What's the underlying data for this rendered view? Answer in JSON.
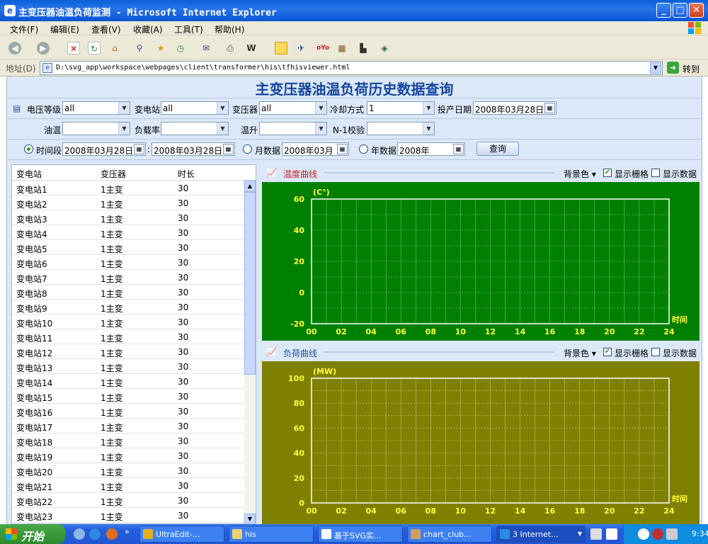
{
  "window": {
    "title": "主变压器油温负荷监测 - Microsoft Internet Explorer",
    "minimize": "_",
    "maximize": "□",
    "close": "✕"
  },
  "menu": [
    "文件(F)",
    "编辑(E)",
    "查看(V)",
    "收藏(A)",
    "工具(T)",
    "帮助(H)"
  ],
  "address": {
    "label": "地址(D)",
    "url": "D:\\svg_app\\workspace\\webpages\\client\\transformer\\his\\tfhisviewer.html",
    "go_label": "转到"
  },
  "page": {
    "title": "主变压器油温负荷历史数据查询"
  },
  "filters": {
    "voltage_label": "电压等级",
    "voltage_value": "all",
    "substation_label": "变电站",
    "substation_value": "all",
    "transformer_label": "变压器",
    "transformer_value": "all",
    "cooling_label": "冷却方式",
    "cooling_value": "1",
    "commission_label": "投产日期",
    "commission_value": "2008年03月28日",
    "oil_temp_label": "油温",
    "oil_temp_value": "",
    "load_rate_label": "负载率",
    "load_rate_value": "",
    "temp_rise_label": "温升",
    "temp_rise_value": "",
    "n1_label": "N-1校验",
    "n1_value": "",
    "period_label": "时间段",
    "period_from": "2008年03月28日",
    "period_sep": ":",
    "period_to": "2008年03月28日",
    "month_label": "月数据",
    "month_value": "2008年03月",
    "year_label": "年数据",
    "year_value": "2008年",
    "query_button": "查询"
  },
  "table": {
    "headers": [
      "变电站",
      "变压器",
      "时长"
    ],
    "rows": [
      {
        "station": "变电站1",
        "transformer": "1主变",
        "duration": "30"
      },
      {
        "station": "变电站2",
        "transformer": "1主变",
        "duration": "30"
      },
      {
        "station": "变电站3",
        "transformer": "1主变",
        "duration": "30"
      },
      {
        "station": "变电站4",
        "transformer": "1主变",
        "duration": "30"
      },
      {
        "station": "变电站5",
        "transformer": "1主变",
        "duration": "30"
      },
      {
        "station": "变电站6",
        "transformer": "1主变",
        "duration": "30"
      },
      {
        "station": "变电站7",
        "transformer": "1主变",
        "duration": "30"
      },
      {
        "station": "变电站8",
        "transformer": "1主变",
        "duration": "30"
      },
      {
        "station": "变电站9",
        "transformer": "1主变",
        "duration": "30"
      },
      {
        "station": "变电站10",
        "transformer": "1主变",
        "duration": "30"
      },
      {
        "station": "变电站11",
        "transformer": "1主变",
        "duration": "30"
      },
      {
        "station": "变电站12",
        "transformer": "1主变",
        "duration": "30"
      },
      {
        "station": "变电站13",
        "transformer": "1主变",
        "duration": "30"
      },
      {
        "station": "变电站14",
        "transformer": "1主变",
        "duration": "30"
      },
      {
        "station": "变电站15",
        "transformer": "1主变",
        "duration": "30"
      },
      {
        "station": "变电站16",
        "transformer": "1主变",
        "duration": "30"
      },
      {
        "station": "变电站17",
        "transformer": "1主变",
        "duration": "30"
      },
      {
        "station": "变电站18",
        "transformer": "1主变",
        "duration": "30"
      },
      {
        "station": "变电站19",
        "transformer": "1主变",
        "duration": "30"
      },
      {
        "station": "变电站20",
        "transformer": "1主变",
        "duration": "30"
      },
      {
        "station": "变电站21",
        "transformer": "1主变",
        "duration": "30"
      },
      {
        "station": "变电站22",
        "transformer": "1主变",
        "duration": "30"
      },
      {
        "station": "变电站23",
        "transformer": "1主变",
        "duration": "30"
      }
    ]
  },
  "charts": {
    "temperature": {
      "title": "温度曲线",
      "bg_label": "背景色",
      "grid_label": "显示栅格",
      "grid_checked": true,
      "data_label": "显示数据",
      "data_checked": false,
      "bg_color": "#008000",
      "unit": "(C°)",
      "xlabel": "时间",
      "ylim": [
        -20,
        60
      ],
      "yticks": [
        "60",
        "40",
        "20",
        "0",
        "-20"
      ],
      "xticks": [
        "00",
        "02",
        "04",
        "06",
        "08",
        "10",
        "12",
        "14",
        "16",
        "18",
        "20",
        "22",
        "24"
      ]
    },
    "load": {
      "title": "负荷曲线",
      "bg_label": "背景色",
      "grid_label": "显示栅格",
      "grid_checked": true,
      "data_label": "显示数据",
      "data_checked": false,
      "bg_color": "#808000",
      "unit": "(MW)",
      "xlabel": "时间",
      "ylim": [
        0,
        100
      ],
      "yticks": [
        "100",
        "80",
        "60",
        "40",
        "20",
        "0"
      ],
      "xticks": [
        "00",
        "02",
        "04",
        "06",
        "08",
        "10",
        "12",
        "14",
        "16",
        "18",
        "20",
        "22",
        "24"
      ]
    }
  },
  "taskbar": {
    "start": "开始",
    "tasks": [
      "UltraEdit-...",
      "his",
      "基于SVG实...",
      "chart_club...",
      "3 Internet..."
    ],
    "clock": "9:34"
  }
}
